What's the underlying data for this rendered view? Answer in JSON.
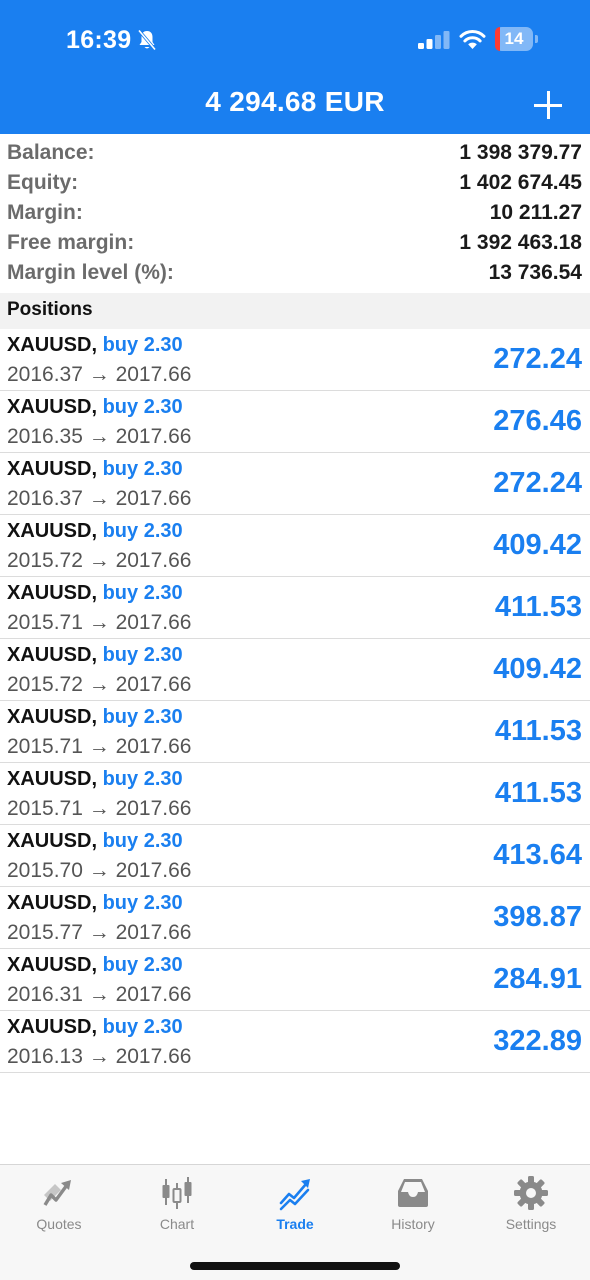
{
  "status_bar": {
    "time": "16:39",
    "battery_level": "14",
    "icons": [
      "bell-slash-icon",
      "cellular-signal-icon",
      "wifi-icon",
      "battery-icon"
    ]
  },
  "header": {
    "title": "4 294.68 EUR",
    "add_icon": "plus-icon"
  },
  "account": [
    {
      "label": "Balance:",
      "value": "1 398 379.77"
    },
    {
      "label": "Equity:",
      "value": "1 402 674.45"
    },
    {
      "label": "Margin:",
      "value": "10 211.27"
    },
    {
      "label": "Free margin:",
      "value": "1 392 463.18"
    },
    {
      "label": "Margin level (%):",
      "value": "13 736.54"
    }
  ],
  "positions_title": "Positions",
  "positions": [
    {
      "symbol": "XAUUSD,",
      "direction": "buy 2.30",
      "prices": "2016.37 → 2017.66",
      "profit": "272.24"
    },
    {
      "symbol": "XAUUSD,",
      "direction": "buy 2.30",
      "prices": "2016.35 → 2017.66",
      "profit": "276.46"
    },
    {
      "symbol": "XAUUSD,",
      "direction": "buy 2.30",
      "prices": "2016.37 → 2017.66",
      "profit": "272.24"
    },
    {
      "symbol": "XAUUSD,",
      "direction": "buy 2.30",
      "prices": "2015.72 → 2017.66",
      "profit": "409.42"
    },
    {
      "symbol": "XAUUSD,",
      "direction": "buy 2.30",
      "prices": "2015.71 → 2017.66",
      "profit": "411.53"
    },
    {
      "symbol": "XAUUSD,",
      "direction": "buy 2.30",
      "prices": "2015.72 → 2017.66",
      "profit": "409.42"
    },
    {
      "symbol": "XAUUSD,",
      "direction": "buy 2.30",
      "prices": "2015.71 → 2017.66",
      "profit": "411.53"
    },
    {
      "symbol": "XAUUSD,",
      "direction": "buy 2.30",
      "prices": "2015.71 → 2017.66",
      "profit": "411.53"
    },
    {
      "symbol": "XAUUSD,",
      "direction": "buy 2.30",
      "prices": "2015.70 → 2017.66",
      "profit": "413.64"
    },
    {
      "symbol": "XAUUSD,",
      "direction": "buy 2.30",
      "prices": "2015.77 → 2017.66",
      "profit": "398.87"
    },
    {
      "symbol": "XAUUSD,",
      "direction": "buy 2.30",
      "prices": "2016.31 → 2017.66",
      "profit": "284.91"
    },
    {
      "symbol": "XAUUSD,",
      "direction": "buy 2.30",
      "prices": "2016.13 → 2017.66",
      "profit": "322.89"
    }
  ],
  "tabs": [
    {
      "label": "Quotes",
      "icon": "quotes-icon",
      "active": false
    },
    {
      "label": "Chart",
      "icon": "candlestick-chart-icon",
      "active": false
    },
    {
      "label": "Trade",
      "icon": "trade-trend-icon",
      "active": true
    },
    {
      "label": "History",
      "icon": "inbox-history-icon",
      "active": false
    },
    {
      "label": "Settings",
      "icon": "gear-icon",
      "active": false
    }
  ],
  "colors": {
    "accent": "#1a7ff0",
    "header_bg": "#1a7ff0",
    "battery_low": "#ff3b30"
  }
}
